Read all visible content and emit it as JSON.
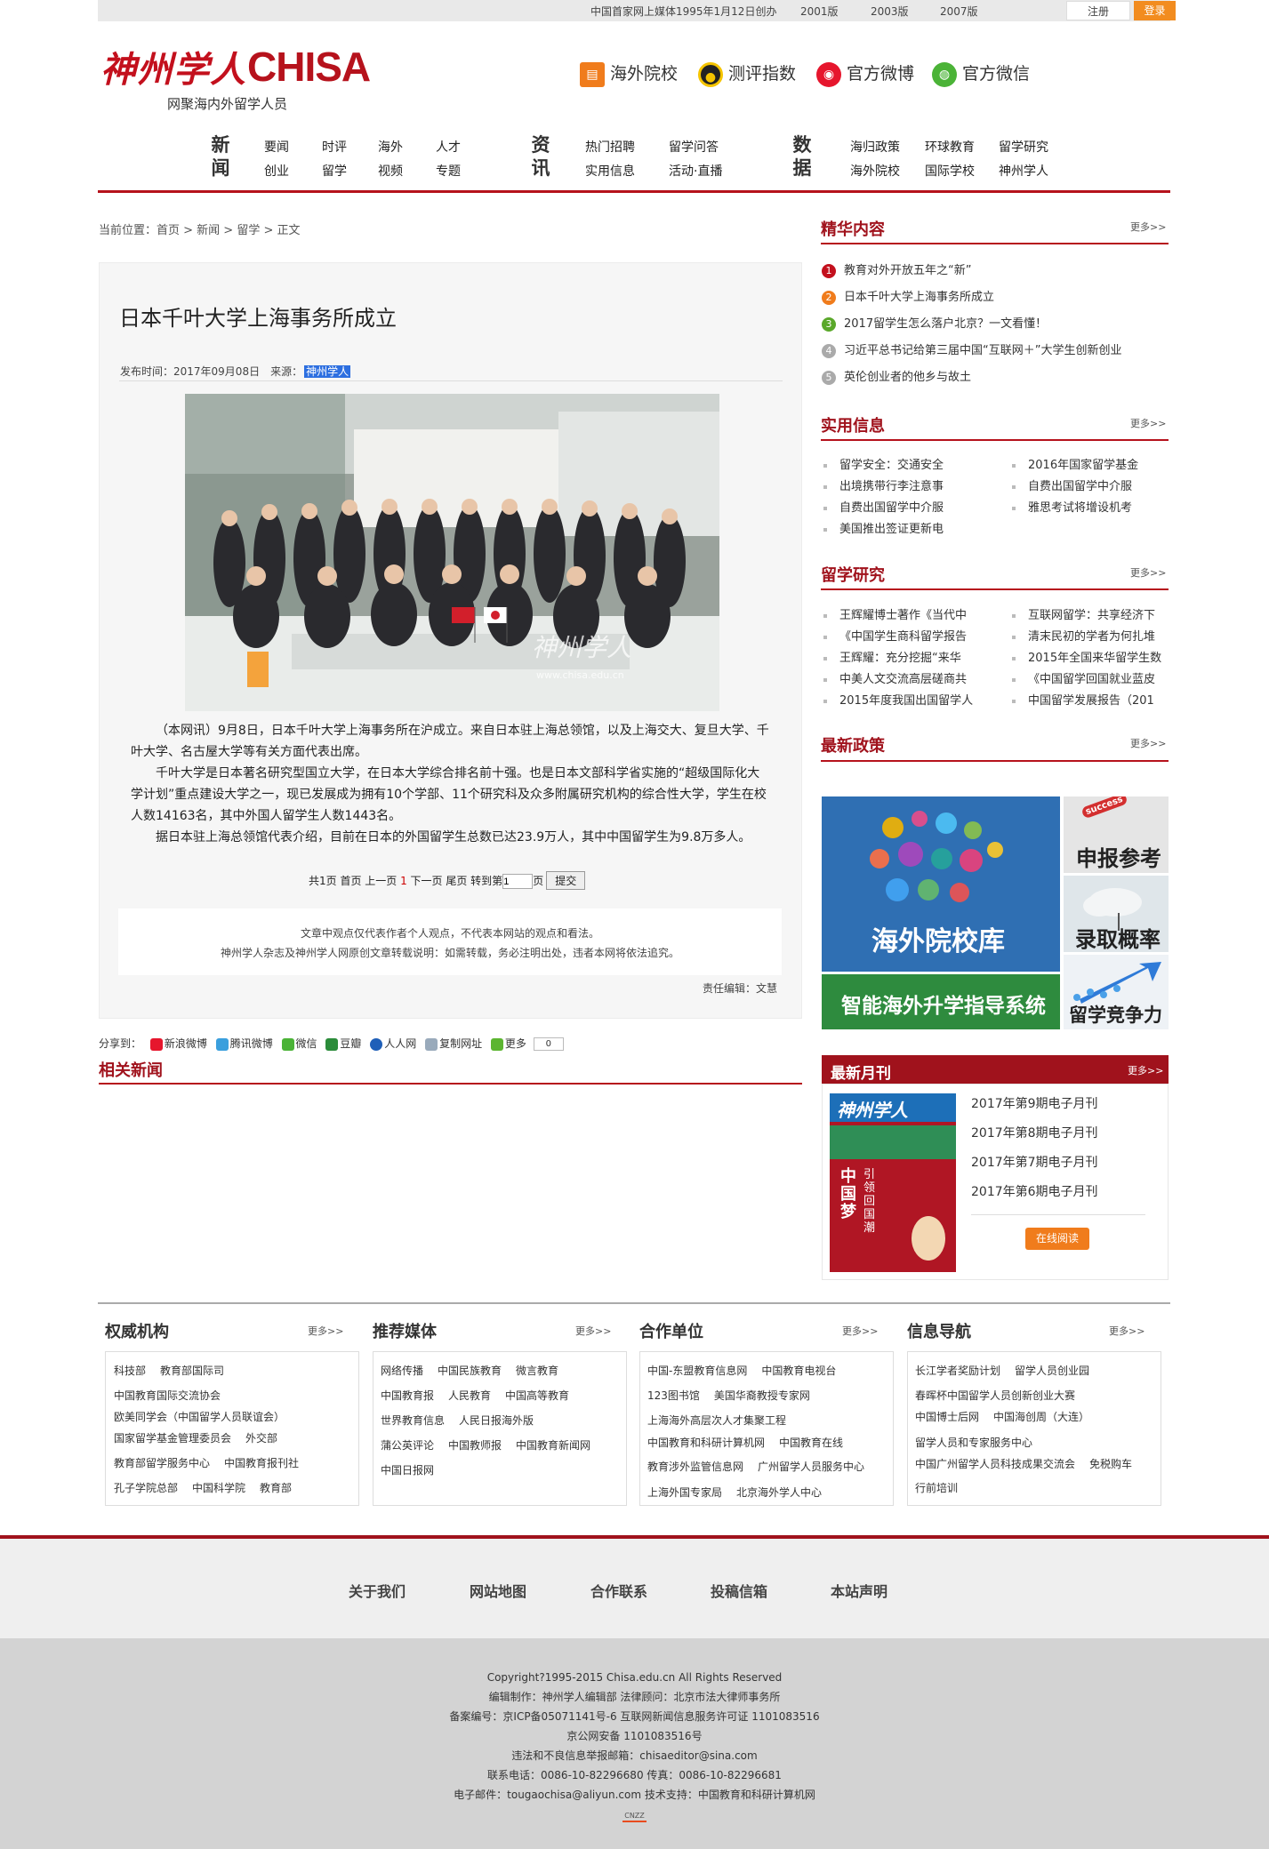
{
  "topbar": {
    "since": "中国首家网上媒体1995年1月12日创办",
    "v2001": "2001版",
    "v2003": "2003版",
    "v2007": "2007版",
    "register": "注册",
    "login": "登录"
  },
  "header": {
    "logo_cn": "神州学人",
    "logo_en": "CHISA",
    "slogan": "网聚海内外留学人员",
    "links": [
      "海外院校",
      "测评指数",
      "官方微博",
      "官方微信"
    ]
  },
  "nav": {
    "news": {
      "title": "新闻",
      "items": [
        "要闻",
        "时评",
        "海外",
        "人才",
        "创业",
        "留学",
        "视频",
        "专题"
      ]
    },
    "info": {
      "title": "资讯",
      "items": [
        "热门招聘",
        "留学问答",
        "实用信息",
        "活动·直播"
      ]
    },
    "data": {
      "title": "数据",
      "items": [
        "海归政策",
        "环球教育",
        "留学研究",
        "海外院校",
        "国际学校",
        "神州学人"
      ]
    }
  },
  "breadcrumb": "当前位置：首页 > 新闻 > 留学 > 正文",
  "article": {
    "title": "日本千叶大学上海事务所成立",
    "meta": "发布时间：2017年09月08日　来源：",
    "source": "神州学人",
    "photo_watermark": "神州学人",
    "photo_url": "www.chisa.edu.cn",
    "paragraphs": [
      "（本网讯）9月8日，日本千叶大学上海事务所在沪成立。来自日本驻上海总领馆，以及上海交大、复旦大学、千叶大学、名古屋大学等有关方面代表出席。",
      "千叶大学是日本著名研究型国立大学，在日本大学综合排名前十强。也是日本文部科学省实施的“超级国际化大学计划”重点建设大学之一，现已发展成为拥有10个学部、11个研究科及众多附属研究机构的综合性大学，学生在校人数14163名，其中外国人留学生人数1443名。",
      "据日本驻上海总领馆代表介绍，目前在日本的外国留学生总数已达23.9万人，其中中国留学生为9.8万多人。"
    ],
    "pager_pre": "共1页  首页  上一页 ",
    "pager_cur": "1",
    "pager_post": " 下一页  尾页  转到第",
    "pager_page": "页",
    "pager_input": "1",
    "pager_go": "提交",
    "disclaimer1": "文章中观点仅代表作者个人观点，不代表本网站的观点和看法。",
    "disclaimer2": "神州学人杂志及神州学人网原创文章转载说明：如需转载，务必注明出处，违者本网将依法追究。",
    "editor": "责任编辑：文慧"
  },
  "share": {
    "label": "分享到：",
    "items": [
      "新浪微博",
      "腾讯微博",
      "微信",
      "豆瓣",
      "人人网",
      "复制网址",
      "更多"
    ],
    "count": "0"
  },
  "related": {
    "title": "相关新闻"
  },
  "sidebar": {
    "more": "更多>>",
    "featured": {
      "title": "精华内容",
      "items": [
        "教育对外开放五年之“新”",
        "日本千叶大学上海事务所成立",
        "2017留学生怎么落户北京？一文看懂！",
        "习近平总书记给第三届中国“互联网＋”大学生创新创业",
        "英伦创业者的他乡与故土"
      ],
      "nums": [
        "1",
        "2",
        "3",
        "4",
        "5"
      ],
      "colors": [
        "#c3101d",
        "#f07c1c",
        "#5aa82a",
        "#aaaaaa",
        "#aaaaaa"
      ]
    },
    "practical": {
      "title": "实用信息",
      "left": [
        "留学安全：交通安全",
        "出境携带行李注意事",
        "自费出国留学中介服",
        "美国推出签证更新电"
      ],
      "right": [
        "2016年国家留学基金",
        "自费出国留学中介服",
        "雅思考试将增设机考"
      ]
    },
    "research": {
      "title": "留学研究",
      "left": [
        "王辉耀博士著作《当代中",
        "《中国学生商科留学报告",
        "王辉耀：充分挖掘“来华",
        "中美人文交流高层磋商共",
        "2015年度我国出国留学人"
      ],
      "right": [
        "互联网留学：共享经济下",
        "清末民初的学者为何扎堆",
        "2015年全国来华留学生数",
        "《中国留学回国就业蓝皮",
        "中国留学发展报告（201"
      ]
    },
    "policy": {
      "title": "最新政策"
    },
    "tiles": {
      "colleges": "海外院校库",
      "apply": "申报参考",
      "success": "success",
      "admit": "录取概率",
      "guide": "智能海外升学指导系统",
      "compete": "留学竞争力"
    },
    "monthly": {
      "title": "最新月刊",
      "more": "更多>>",
      "items": [
        "2017年第9期电子月刊",
        "2017年第8期电子月刊",
        "2017年第7期电子月刊",
        "2017年第6期电子月刊"
      ],
      "read": "在线阅读",
      "cover_title": "神州学人",
      "cover_dream": "中国梦",
      "cover_line": "引领回国潮"
    }
  },
  "bottom": {
    "more": "更多>>",
    "authority": {
      "title": "权威机构",
      "rows": [
        [
          "科技部",
          "教育部国际司"
        ],
        [
          "中国教育国际交流协会"
        ],
        [
          "欧美同学会（中国留学人员联谊会）"
        ],
        [
          "国家留学基金管理委员会",
          "外交部"
        ],
        [
          "教育部留学服务中心",
          "中国教育报刊社"
        ],
        [
          "孔子学院总部",
          "中国科学院",
          "教育部"
        ]
      ]
    },
    "media": {
      "title": "推荐媒体",
      "rows": [
        [
          "网络传播",
          "中国民族教育",
          "微言教育"
        ],
        [
          "中国教育报",
          "人民教育",
          "中国高等教育"
        ],
        [
          "世界教育信息",
          "人民日报海外版"
        ],
        [
          "蒲公英评论",
          "中国教师报",
          "中国教育新闻网"
        ],
        [
          "中国日报网"
        ]
      ]
    },
    "partners": {
      "title": "合作单位",
      "rows": [
        [
          "中国-东盟教育信息网",
          "中国教育电视台"
        ],
        [
          "123图书馆",
          "美国华裔教授专家网"
        ],
        [
          "上海海外高层次人才集聚工程"
        ],
        [
          "中国教育和科研计算机网",
          "中国教育在线"
        ],
        [
          "教育涉外监管信息网",
          "广州留学人员服务中心"
        ],
        [
          "上海外国专家局",
          "北京海外学人中心"
        ]
      ]
    },
    "infonav": {
      "title": "信息导航",
      "rows": [
        [
          "长江学者奖励计划",
          "留学人员创业园"
        ],
        [
          "春晖杯中国留学人员创新创业大赛"
        ],
        [
          "中国博士后网",
          "中国海创周（大连）"
        ],
        [
          "留学人员和专家服务中心"
        ],
        [
          "中国广州留学人员科技成果交流会",
          "免税购车"
        ],
        [
          "行前培训"
        ]
      ]
    }
  },
  "footer": {
    "links": [
      "关于我们",
      "网站地图",
      "合作联系",
      "投稿信箱",
      "本站声明"
    ],
    "lines": [
      "Copyright?1995-2015 Chisa.edu.cn All Rights Reserved",
      "编辑制作：神州学人编辑部 法律顾问：北京市法大律师事务所",
      "备案编号：京ICP备05071141号-6 互联网新闻信息服务许可证 1101083516",
      "京公网安备 1101083516号",
      "违法和不良信息举报邮箱：chisaeditor@sina.com",
      "联系电话：0086-10-82296680 传真：0086-10-82296681",
      "电子邮件：tougaochisa@aliyun.com 技术支持：中国教育和科研计算机网"
    ],
    "badge": "CNZZ"
  },
  "colors": {
    "brand_red": "#b6121c",
    "orange": "#f28c1f"
  }
}
